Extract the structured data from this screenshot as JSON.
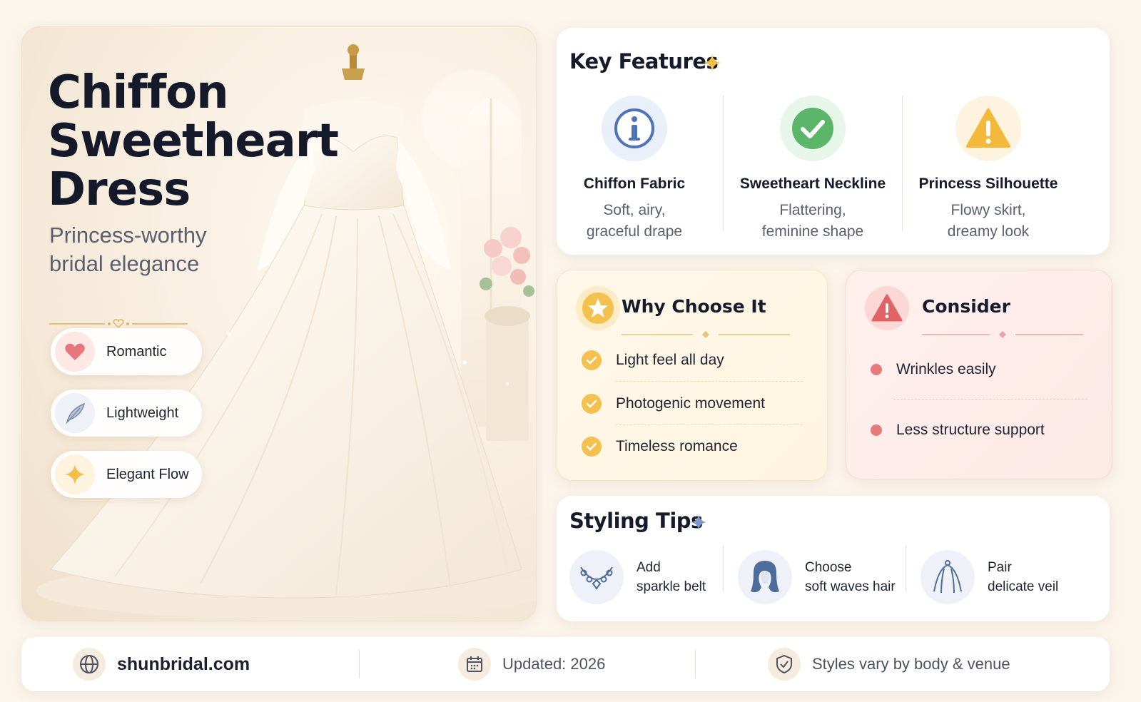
{
  "hero": {
    "title_lines": [
      "Chiffon",
      "Sweetheart",
      "Dress"
    ],
    "subtitle_lines": [
      "Princess-worthy",
      "bridal elegance"
    ],
    "tags": [
      {
        "label": "Romantic",
        "icon": "heart-icon",
        "color": "#e8767c"
      },
      {
        "label": "Lightweight",
        "icon": "feather-icon",
        "color": "#7a8ba6"
      },
      {
        "label": "Elegant Flow",
        "icon": "sparkle-icon",
        "color": "#f2bf48"
      }
    ]
  },
  "features": {
    "title": "Key Features",
    "items": [
      {
        "name": "Chiffon Fabric",
        "desc_lines": [
          "Soft, airy,",
          "graceful drape"
        ],
        "icon": "info-icon",
        "color": "#4f73b8"
      },
      {
        "name": "Sweetheart Neckline",
        "desc_lines": [
          "Flattering,",
          "feminine shape"
        ],
        "icon": "check-circle-icon",
        "color": "#5cb66a"
      },
      {
        "name": "Princess Silhouette",
        "desc_lines": [
          "Flowy skirt,",
          "dreamy look"
        ],
        "icon": "warning-icon",
        "color": "#f3b93a"
      }
    ]
  },
  "why": {
    "title": "Why Choose It",
    "items": [
      "Light feel all day",
      "Photogenic movement",
      "Timeless romance"
    ],
    "accent": "#f4c04e"
  },
  "consider": {
    "title": "Consider",
    "items": [
      "Wrinkles easily",
      "Less structure support"
    ],
    "accent": "#e57b7b"
  },
  "tips": {
    "title": "Styling Tips",
    "items": [
      {
        "lines": [
          "Add",
          "sparkle belt"
        ],
        "icon": "necklace-icon"
      },
      {
        "lines": [
          "Choose",
          "soft waves hair"
        ],
        "icon": "hair-icon"
      },
      {
        "lines": [
          "Pair",
          "delicate veil"
        ],
        "icon": "veil-icon"
      }
    ]
  },
  "footer": {
    "site": "shunbridal.com",
    "updated": "Updated: 2026",
    "note": "Styles vary by body & venue",
    "icons": [
      "globe-icon",
      "calendar-icon",
      "shield-check-icon"
    ]
  }
}
